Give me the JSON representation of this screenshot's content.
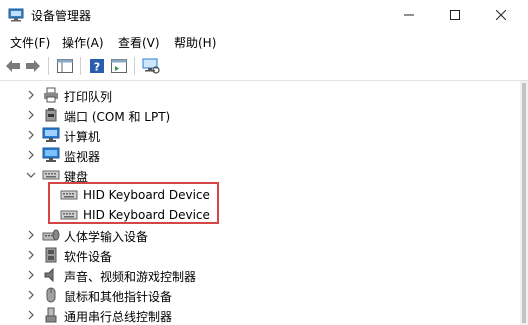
{
  "window": {
    "title": "设备管理器"
  },
  "menu": {
    "file": "文件(F)",
    "action": "操作(A)",
    "view": "查看(V)",
    "help": "帮助(H)"
  },
  "tree": {
    "items": [
      {
        "label": "打印队列",
        "icon": "printer-queue-icon",
        "expanded": false
      },
      {
        "label": "端口 (COM 和 LPT)",
        "icon": "port-icon",
        "expanded": false
      },
      {
        "label": "计算机",
        "icon": "computer-icon",
        "expanded": false
      },
      {
        "label": "监视器",
        "icon": "monitor-icon",
        "expanded": false
      },
      {
        "label": "键盘",
        "icon": "keyboard-icon",
        "expanded": true,
        "children": [
          {
            "label": "HID Keyboard Device",
            "icon": "keyboard-icon"
          },
          {
            "label": "HID Keyboard Device",
            "icon": "keyboard-icon"
          }
        ]
      },
      {
        "label": "人体学输入设备",
        "icon": "hid-icon",
        "expanded": false
      },
      {
        "label": "软件设备",
        "icon": "software-device-icon",
        "expanded": false
      },
      {
        "label": "声音、视频和游戏控制器",
        "icon": "speaker-icon",
        "expanded": false
      },
      {
        "label": "鼠标和其他指针设备",
        "icon": "mouse-icon",
        "expanded": false
      },
      {
        "label": "通用串行总线控制器",
        "icon": "usb-icon",
        "expanded": false
      }
    ]
  },
  "colors": {
    "highlight_border": "#d64545",
    "icon_blue": "#2a7bd3"
  }
}
